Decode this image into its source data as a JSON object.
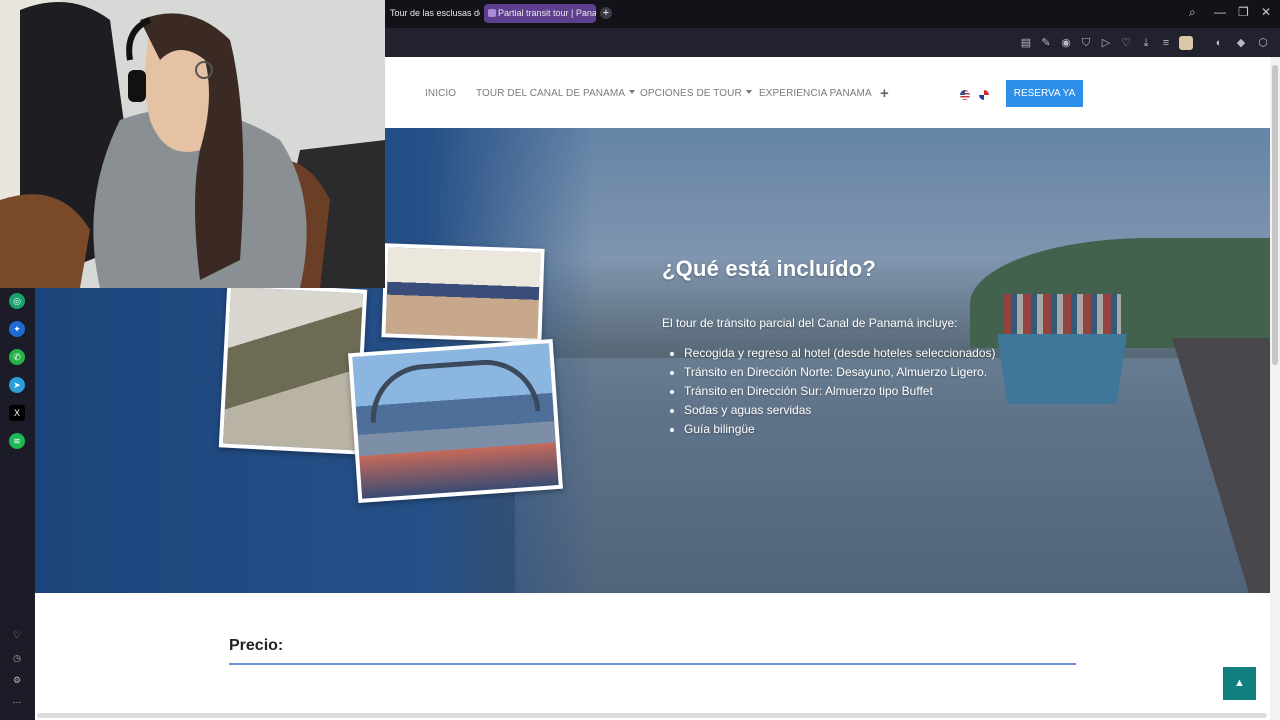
{
  "browser": {
    "tabs": [
      {
        "label": "Tour de las esclusas de M"
      },
      {
        "label": "Partial transit tour | Panam"
      }
    ],
    "window_controls": {
      "search": "⌕",
      "minimize": "—",
      "restore": "❐",
      "close": "✕"
    }
  },
  "site": {
    "nav": [
      {
        "label": "INICIO"
      },
      {
        "label": "TOUR DEL CANAL DE PANAMA"
      },
      {
        "label": "OPCIONES DE TOUR"
      },
      {
        "label": "EXPERIENCIA PANAMA"
      }
    ],
    "plus": "+",
    "cta": "RESERVA YA"
  },
  "hero": {
    "title": "¿Qué está incluído?",
    "intro": "El tour de tránsito parcial del Canal de Panamá incluye:",
    "items": [
      "Recogida y regreso al hotel (desde hoteles seleccionados)",
      "Tránsito en Dirección Norte: Desayuno, Almuerzo Ligero.",
      "Tránsito en Dirección Sur: Almuerzo tipo Buffet",
      "Sodas y aguas servidas",
      "Guía bilingüe"
    ]
  },
  "precio": {
    "heading": "Precio:"
  },
  "colors": {
    "accent": "#2d8fea",
    "tab_active": "#5e3f8e",
    "to_top": "#117f80",
    "divider": "#6c8fd0"
  },
  "icons": {
    "to_top": "up-arrow-icon"
  }
}
